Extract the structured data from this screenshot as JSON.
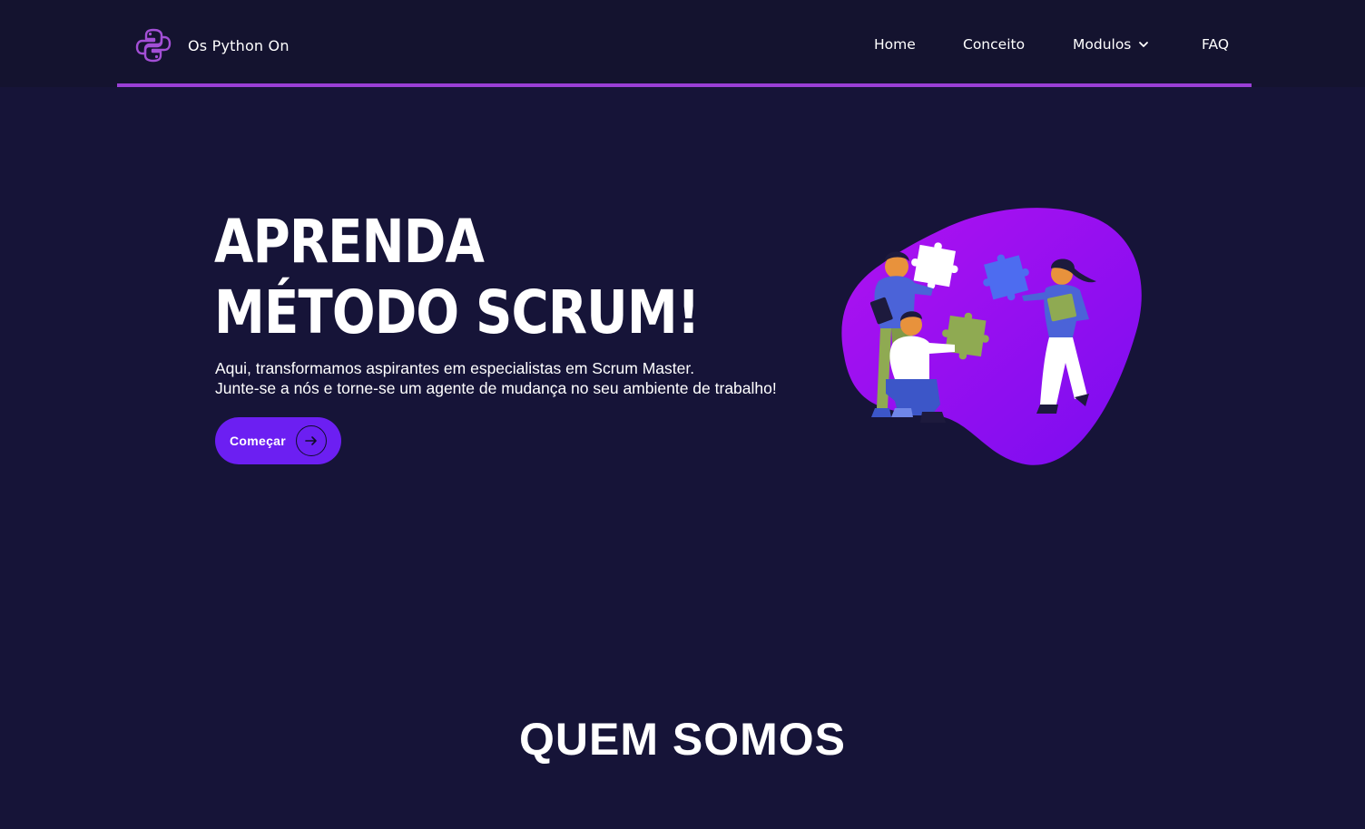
{
  "brand": {
    "name": "Os Python On",
    "logo_icon": "python-logo-icon",
    "accent": "#9a3fd6"
  },
  "nav": {
    "home": "Home",
    "conceito": "Conceito",
    "modulos": "Modulos",
    "faq": "FAQ"
  },
  "hero": {
    "title_line1": "APRENDA",
    "title_line2": "MÉTODO SCRUM!",
    "subtitle_line1": "Aqui, transformamos aspirantes em especialistas em Scrum Master.",
    "subtitle_line2": "Junte-se a nós e torne-se um agente de mudança no seu ambiente de trabalho!",
    "cta_label": "Começar",
    "cta_color": "#6c1ff2"
  },
  "sections": {
    "quem_somos": "QUEM SOMOS"
  },
  "colors": {
    "background": "#161438",
    "header": "#14132f",
    "blob": "#9b10f0"
  }
}
